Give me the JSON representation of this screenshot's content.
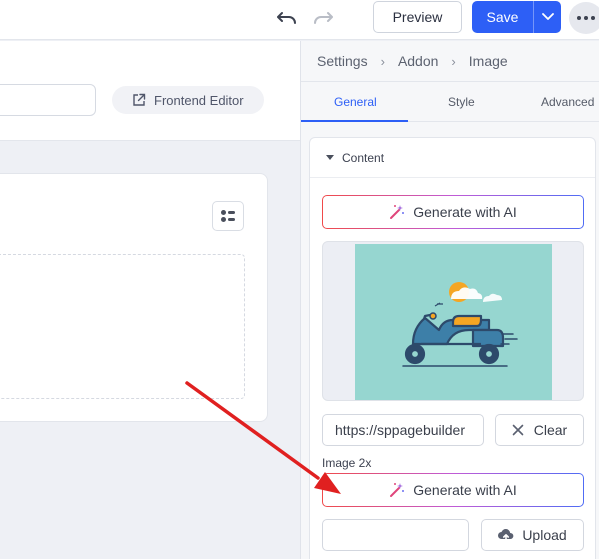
{
  "topbar": {
    "preview_label": "Preview",
    "save_label": "Save"
  },
  "canvas": {
    "frontend_editor_label": "Frontend Editor"
  },
  "panel": {
    "breadcrumb": [
      "Settings",
      "Addon",
      "Image"
    ],
    "tabs": [
      {
        "label": "General",
        "active": true
      },
      {
        "label": "Style",
        "active": false
      },
      {
        "label": "Advanced",
        "active": false
      }
    ],
    "section_title": "Content",
    "generate_ai_label": "Generate with AI",
    "image_url_value": "https://sppagebuilder",
    "clear_label": "Clear",
    "image_2x_label": "Image 2x",
    "generate_ai_label_2": "Generate with AI",
    "upload_label": "Upload"
  },
  "colors": {
    "accent": "#2d5ff6",
    "annotation_arrow": "#e02020"
  }
}
